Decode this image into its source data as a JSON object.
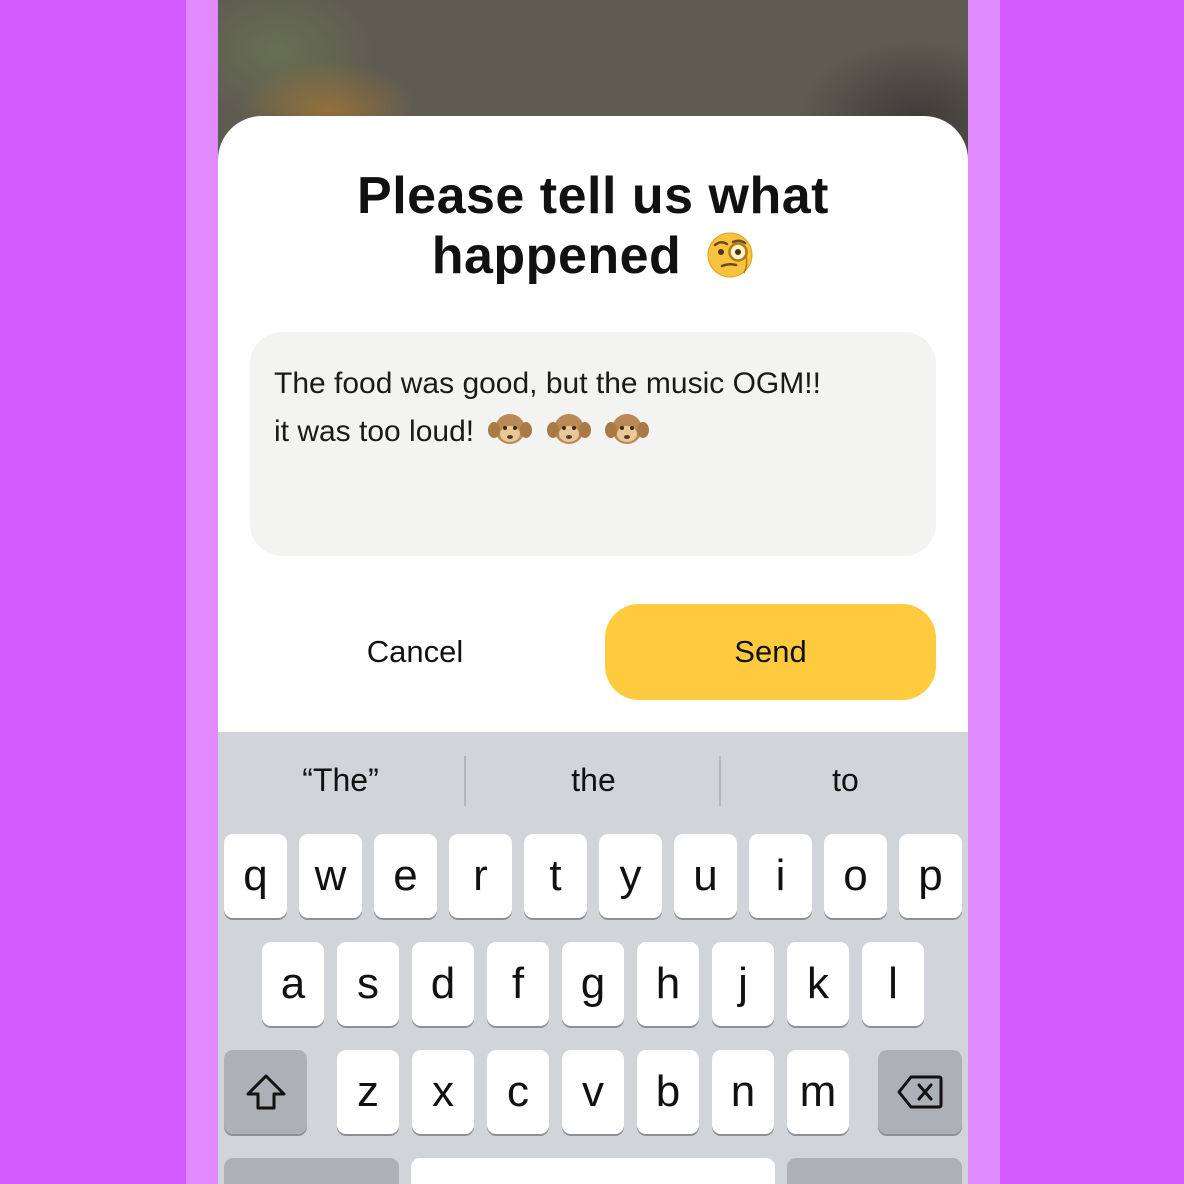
{
  "dialog": {
    "title_line1": "Please tell us what",
    "title_line2": "happened",
    "title_emoji": "face-with-monocle",
    "feedback_text_line1": "The food was good, but the music OGM!!",
    "feedback_text_line2": "it was too loud!",
    "feedback_emoji": "hear-no-evil-monkey",
    "feedback_emoji_count": 3,
    "cancel_label": "Cancel",
    "send_label": "Send"
  },
  "keyboard": {
    "suggestions": [
      "“The”",
      "the",
      "to"
    ],
    "row1": [
      "q",
      "w",
      "e",
      "r",
      "t",
      "y",
      "u",
      "i",
      "o",
      "p"
    ],
    "row2": [
      "a",
      "s",
      "d",
      "f",
      "g",
      "h",
      "j",
      "k",
      "l"
    ],
    "row3": [
      "z",
      "x",
      "c",
      "v",
      "b",
      "n",
      "m"
    ],
    "shift_icon": "shift-icon",
    "backspace_icon": "backspace-icon"
  },
  "colors": {
    "outer_background": "#d35bff",
    "frame": "#e189ff",
    "send_button": "#fdcb3d",
    "input_background": "#f3f3f1",
    "keyboard_background": "#d1d4d8"
  }
}
